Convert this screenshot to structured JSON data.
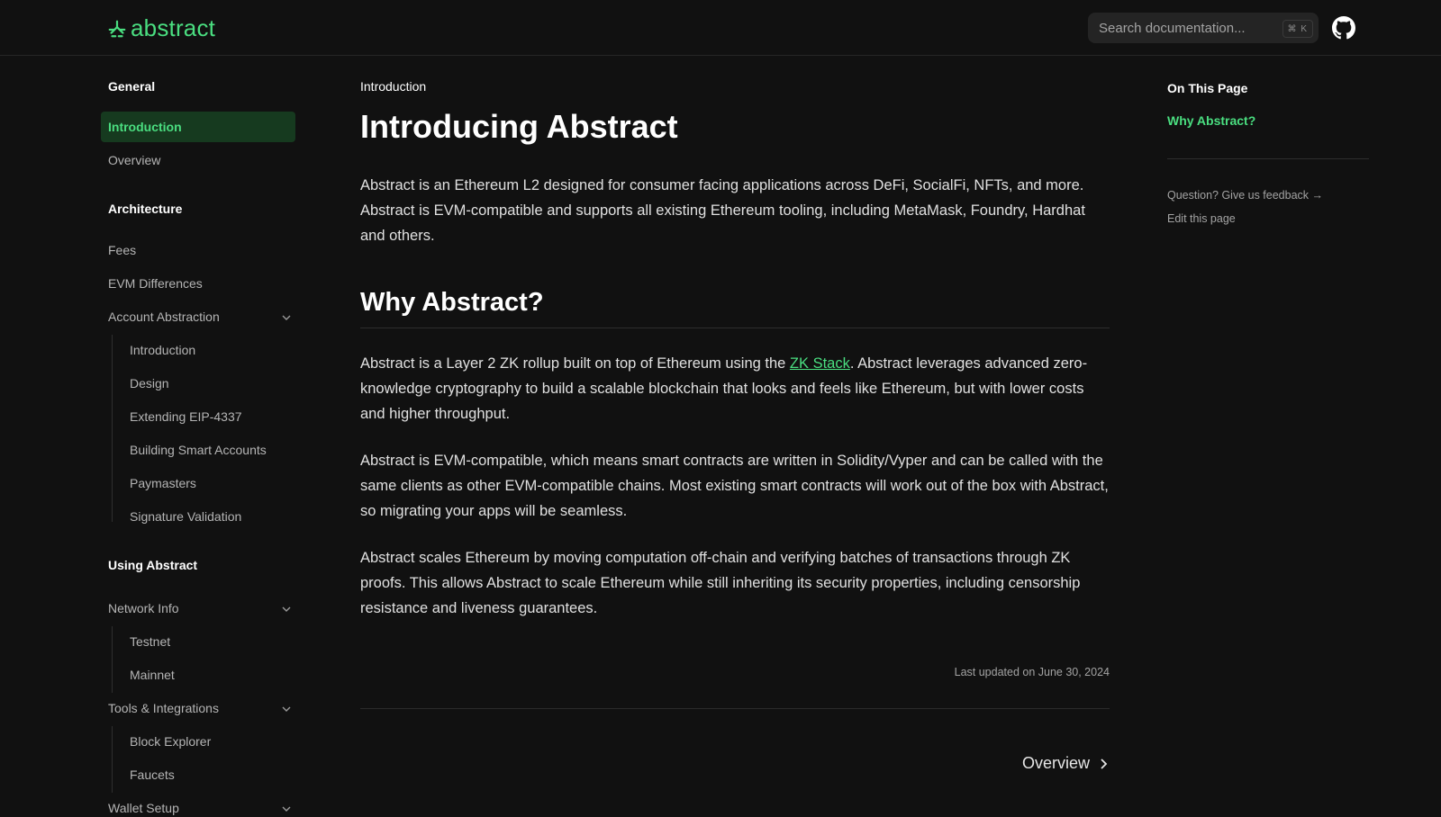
{
  "header": {
    "logo_text": "abstract",
    "search_placeholder": "Search documentation...",
    "search_shortcut": "⌘ K",
    "accent_color": "#4ade80"
  },
  "sidebar": {
    "groups": [
      {
        "title": "General"
      },
      {
        "title": "Architecture"
      },
      {
        "title": "Using Abstract"
      }
    ],
    "general": [
      "Introduction",
      "Overview"
    ],
    "architecture": [
      "Fees",
      "EVM Differences",
      "Account Abstraction"
    ],
    "account_abstraction": [
      "Introduction",
      "Design",
      "Extending EIP-4337",
      "Building Smart Accounts",
      "Paymasters",
      "Signature Validation"
    ],
    "using_abstract": [
      "Network Info",
      "Tools & Integrations",
      "Wallet Setup"
    ],
    "network_info": [
      "Testnet",
      "Mainnet"
    ],
    "tools": [
      "Block Explorer",
      "Faucets"
    ]
  },
  "main": {
    "breadcrumb": "Introduction",
    "title": "Introducing Abstract",
    "intro": "Abstract is an Ethereum L2 designed for consumer facing applications across DeFi, SocialFi, NFTs, and more. Abstract is EVM-compatible and supports all existing Ethereum tooling, including MetaMask, Foundry, Hardhat and others.",
    "section_title": "Why Abstract?",
    "p1_before": "Abstract is a Layer 2 ZK rollup built on top of Ethereum using the ",
    "p1_link": "ZK Stack",
    "p1_after": ". Abstract leverages advanced zero-knowledge cryptography to build a scalable blockchain that looks and feels like Ethereum, but with lower costs and higher throughput.",
    "p2": "Abstract is EVM-compatible, which means smart contracts are written in Solidity/Vyper and can be called with the same clients as other EVM-compatible chains. Most existing smart contracts will work out of the box with Abstract, so migrating your apps will be seamless.",
    "p3": "Abstract scales Ethereum by moving computation off-chain and verifying batches of transactions through ZK proofs. This allows Abstract to scale Ethereum while still inheriting its security properties, including censorship resistance and liveness guarantees.",
    "last_updated": "Last updated on June 30, 2024",
    "next_label": "Overview"
  },
  "toc": {
    "title": "On This Page",
    "items": [
      "Why Abstract?"
    ],
    "feedback": "Question? Give us feedback →",
    "edit": "Edit this page"
  }
}
